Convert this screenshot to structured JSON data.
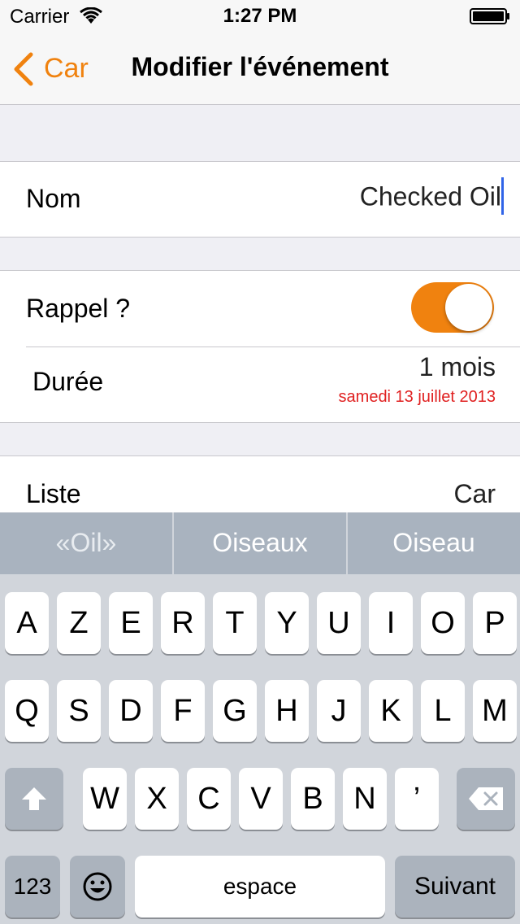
{
  "status_bar": {
    "carrier": "Carrier",
    "time": "1:27 PM"
  },
  "nav": {
    "back_label": "Car",
    "title": "Modifier l'événement"
  },
  "fields": {
    "name_label": "Nom",
    "name_value": "Checked Oil",
    "reminder_label": "Rappel ?",
    "reminder_on": true,
    "duration_label": "Durée",
    "duration_value": "1 mois",
    "duration_date": "samedi 13 juillet 2013",
    "list_label": "Liste",
    "list_value": "Car"
  },
  "keyboard": {
    "suggestions": [
      "«Oil»",
      "Oiseaux",
      "Oiseau"
    ],
    "row1": [
      "A",
      "Z",
      "E",
      "R",
      "T",
      "Y",
      "U",
      "I",
      "O",
      "P"
    ],
    "row2": [
      "Q",
      "S",
      "D",
      "F",
      "G",
      "H",
      "J",
      "K",
      "L",
      "M"
    ],
    "row3": [
      "W",
      "X",
      "C",
      "V",
      "B",
      "N",
      "’"
    ],
    "numbers_label": "123",
    "space_label": "espace",
    "next_label": "Suivant"
  },
  "colors": {
    "accent": "#f0820f",
    "date_red": "#e02020",
    "cursor": "#3064e8"
  }
}
